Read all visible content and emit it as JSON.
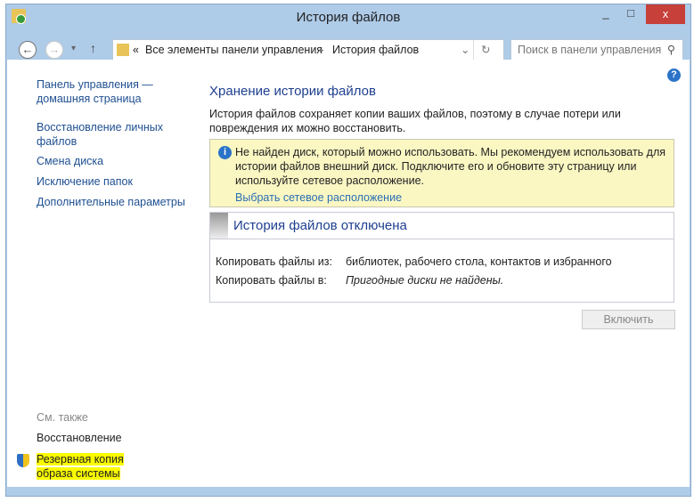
{
  "window": {
    "title": "История файлов",
    "minimize": "_",
    "maximize": "□",
    "close": "x"
  },
  "nav": {
    "back": "←",
    "forward": "→",
    "dropdown": "▾",
    "up": "↑",
    "breadcrumb_prefix": "«",
    "crumbs": [
      "Все элементы панели управления",
      "История файлов"
    ],
    "sep": "▸",
    "refresh": "↻",
    "addr_dropdown": "⌄",
    "search_placeholder": "Поиск в панели управления",
    "search_icon": "⚲"
  },
  "sidebar": {
    "items": [
      "Панель управления — домашняя страница",
      "Восстановление личных файлов",
      "Смена диска",
      "Исключение папок",
      "Дополнительные параметры"
    ],
    "see_also": "См. также",
    "see_also_items": [
      "Восстановление",
      "Резервная копия образа системы"
    ]
  },
  "main": {
    "title": "Хранение истории файлов",
    "description": "История файлов сохраняет копии ваших файлов, поэтому в случае потери или повреждения их можно восстановить.",
    "warning": {
      "text": "Не найден диск, который можно использовать. Мы рекомендуем использовать для истории файлов внешний диск. Подключите его и обновите эту страницу или используйте сетевое расположение.",
      "link": "Выбрать сетевое расположение"
    },
    "status": {
      "title": "История файлов отключена",
      "rows": [
        {
          "label": "Копировать файлы из:",
          "value": "библиотек, рабочего стола, контактов и избранного"
        },
        {
          "label": "Копировать файлы в:",
          "value": "Пригодные диски не найдены."
        }
      ]
    },
    "enable_button": "Включить",
    "help": "?"
  }
}
